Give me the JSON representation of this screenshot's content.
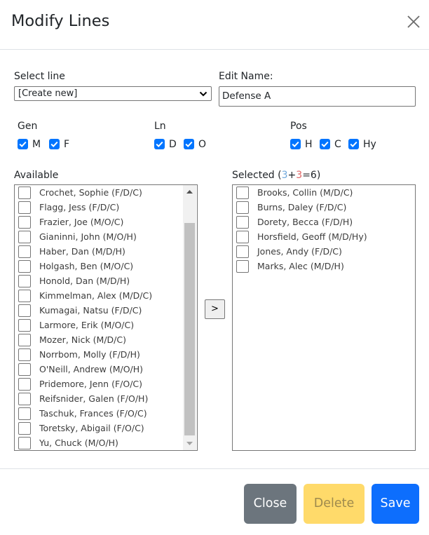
{
  "modal": {
    "title": "Modify Lines",
    "close_icon": "close-icon"
  },
  "form": {
    "select_line_label": "Select line",
    "select_line_value": "[Create new]",
    "edit_name_label": "Edit Name:",
    "edit_name_value": "Defense A"
  },
  "filters": {
    "gen": {
      "label": "Gen",
      "options": [
        {
          "label": "M",
          "checked": true
        },
        {
          "label": "F",
          "checked": true
        }
      ]
    },
    "ln": {
      "label": "Ln",
      "options": [
        {
          "label": "D",
          "checked": true
        },
        {
          "label": "O",
          "checked": true
        }
      ]
    },
    "pos": {
      "label": "Pos",
      "options": [
        {
          "label": "H",
          "checked": true
        },
        {
          "label": "C",
          "checked": true
        },
        {
          "label": "Hy",
          "checked": true
        }
      ]
    }
  },
  "available": {
    "label": "Available",
    "items": [
      "Crochet, Sophie (F/D/C)",
      "Flagg, Jess (F/D/C)",
      "Frazier, Joe (M/O/C)",
      "Gianinni, John (M/O/H)",
      "Haber, Dan (M/D/H)",
      "Holgash, Ben (M/O/C)",
      "Honold, Dan (M/D/H)",
      "Kimmelman, Alex (M/D/C)",
      "Kumagai, Natsu (F/D/C)",
      "Larmore, Erik (M/O/C)",
      "Mozer, Nick (M/D/C)",
      "Norrbom, Molly (F/D/H)",
      "O'Neill, Andrew (M/O/H)",
      "Pridemore, Jenn (F/O/C)",
      "Reifsnider, Galen (F/O/H)",
      "Taschuk, Frances (F/O/C)",
      "Toretsky, Abigail (F/O/C)",
      "Yu, Chuck (M/O/H)"
    ]
  },
  "selected": {
    "label_prefix": "Selected (",
    "count_a": "3",
    "plus": "+",
    "count_b": "3",
    "total": "=6)",
    "color_a": "#6fa8dc",
    "color_b": "#e06666",
    "items": [
      "Brooks, Collin (M/D/C)",
      "Burns, Daley (F/D/C)",
      "Dorety, Becca (F/D/H)",
      "Horsfield, Geoff (M/D/Hy)",
      "Jones, Andy (F/D/C)",
      "Marks, Alec (M/D/H)"
    ]
  },
  "move_button": ">",
  "buttons": {
    "close": {
      "label": "Close",
      "color": "#6c757d"
    },
    "delete": {
      "label": "Delete",
      "color": "#ffda6a"
    },
    "save": {
      "label": "Save",
      "color": "#0d6efd"
    }
  }
}
